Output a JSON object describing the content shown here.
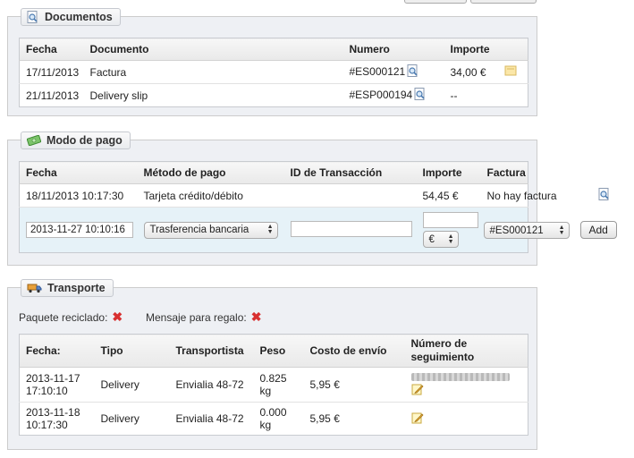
{
  "documentos": {
    "title": "Documentos",
    "headers": [
      "Fecha",
      "Documento",
      "Numero",
      "Importe"
    ],
    "rows": [
      {
        "fecha": "17/11/2013",
        "documento": "Factura",
        "numero": "#ES000121",
        "importe": "34,00 €"
      },
      {
        "fecha": "21/11/2013",
        "documento": "Delivery slip",
        "numero": "#ESP000194",
        "importe": "--"
      }
    ]
  },
  "modo_pago": {
    "title": "Modo de pago",
    "headers": [
      "Fecha",
      "Método de pago",
      "ID de Transacción",
      "Importe",
      "Factura"
    ],
    "row": {
      "fecha": "18/11/2013 10:17:30",
      "metodo": "Tarjeta crédito/débito",
      "id": "",
      "importe": "54,45 €",
      "factura": "No hay factura"
    },
    "form": {
      "date_value": "2013-11-27 10:10:16",
      "method_value": "Trasferencia bancaria",
      "currency_value": "€",
      "invoice_value": "#ES000121",
      "add_label": "Add"
    }
  },
  "transporte": {
    "title": "Transporte",
    "paquete_label": "Paquete reciclado:",
    "regalo_label": "Mensaje para regalo:",
    "headers": [
      "Fecha:",
      "Tipo",
      "Transportista",
      "Peso",
      "Costo de envío",
      "Número de seguimiento"
    ],
    "rows": [
      {
        "fecha1": "2013-11-17",
        "fecha2": "17:10:10",
        "tipo": "Delivery",
        "transportista": "Envialia 48-72",
        "peso1": "0.825",
        "peso2": "kg",
        "costo": "5,95 €"
      },
      {
        "fecha1": "2013-11-18",
        "fecha2": "10:17:30",
        "tipo": "Delivery",
        "transportista": "Envialia 48-72",
        "peso1": "0.000",
        "peso2": "kg",
        "costo": "5,95 €"
      }
    ]
  },
  "colors": {
    "panel_bg": "#eef0f4",
    "input_row_bg": "#e6f2f8",
    "error_red": "#d83030"
  },
  "icons": [
    "document-search-icon",
    "magnifier-document-icon",
    "note-icon",
    "money-icon",
    "truck-icon",
    "cross-icon",
    "edit-pencil-icon"
  ]
}
